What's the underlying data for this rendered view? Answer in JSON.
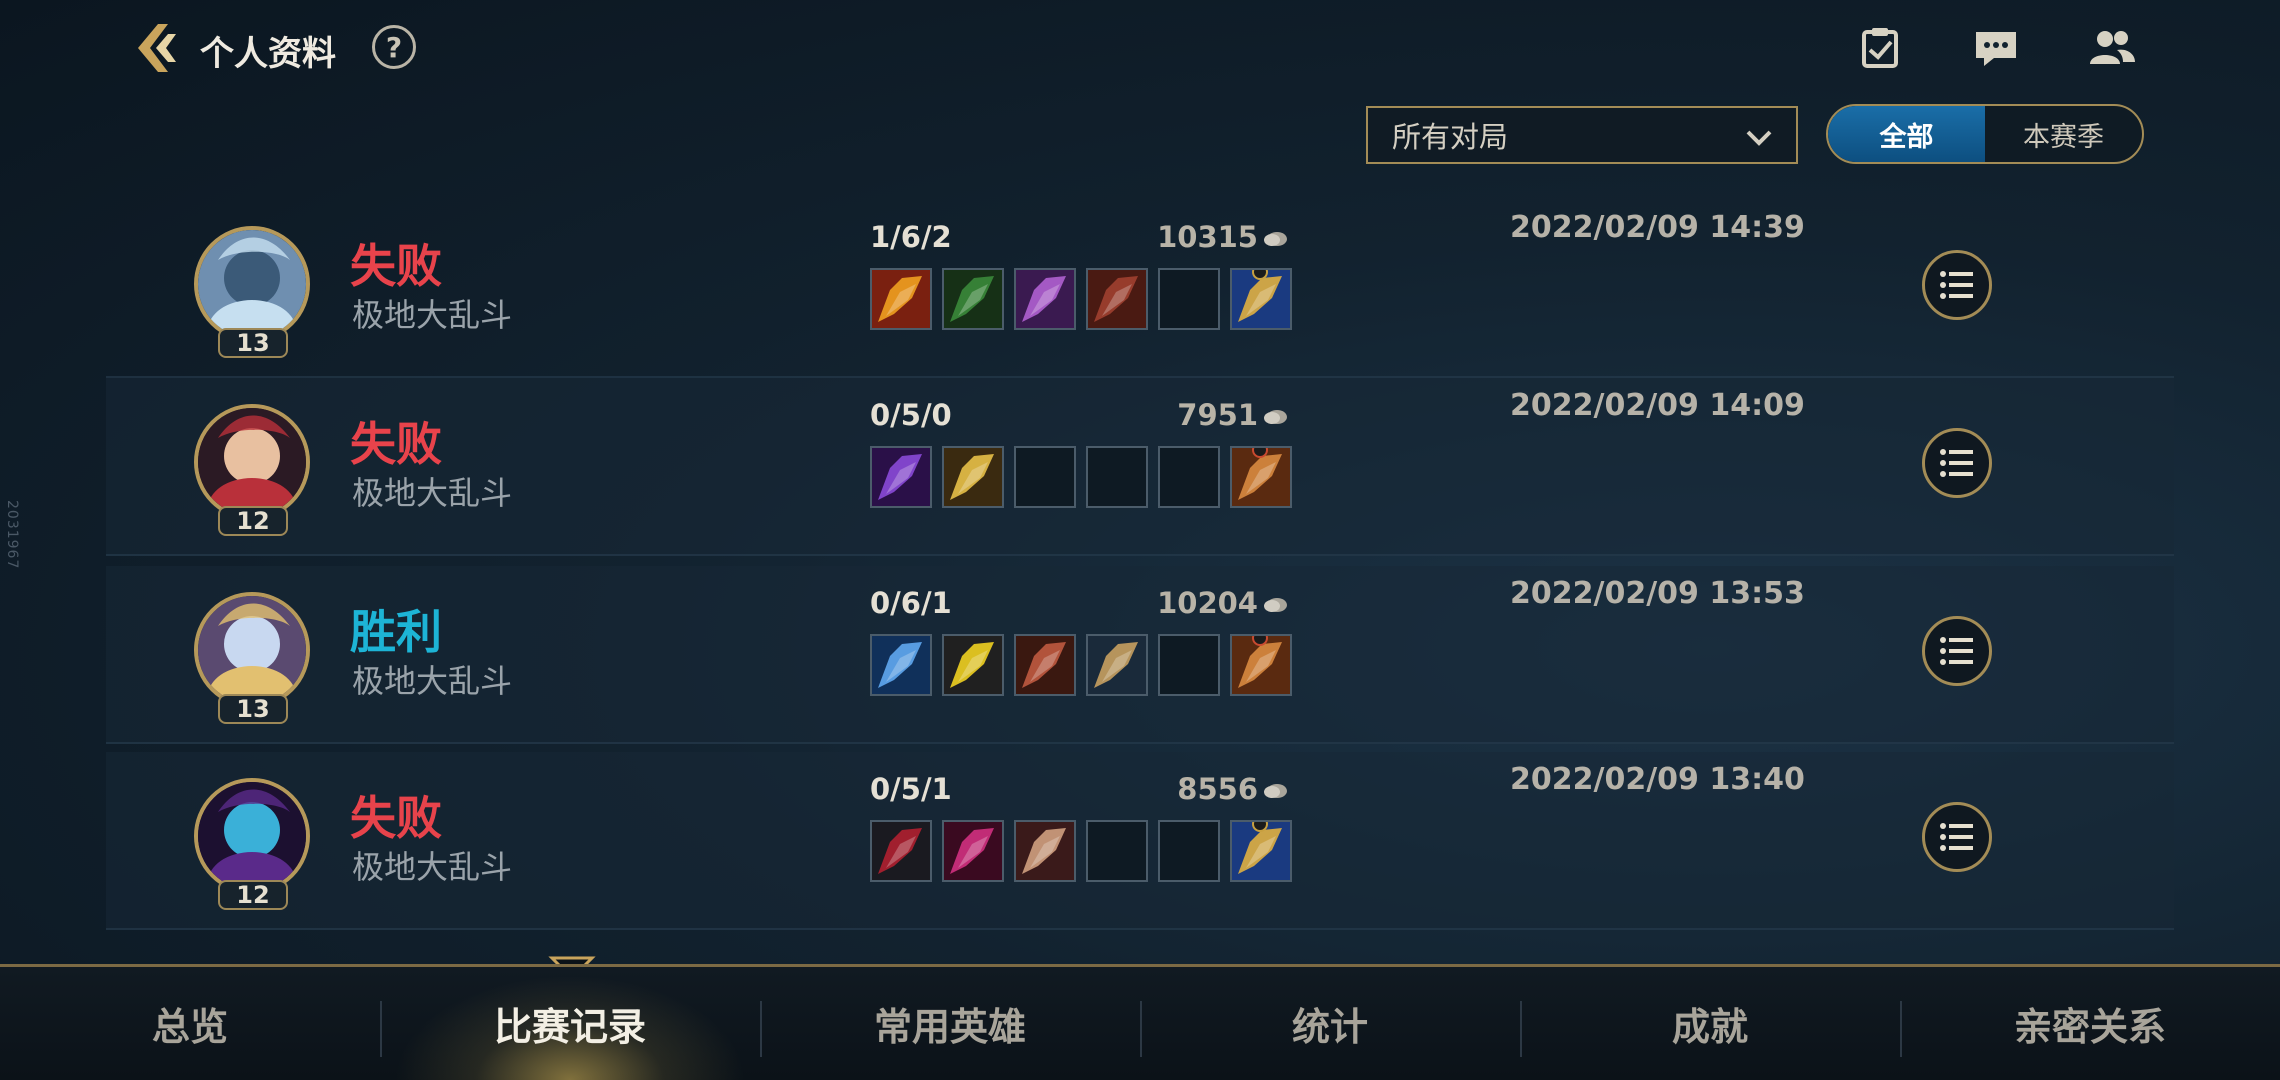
{
  "header": {
    "title": "个人资料",
    "help_label": "?"
  },
  "side_watermark": "2031967",
  "filters": {
    "match_type": "所有对局",
    "scope_tabs": [
      {
        "label": "全部",
        "active": true
      },
      {
        "label": "本赛季",
        "active": false
      }
    ]
  },
  "matches": [
    {
      "result": "失败",
      "result_type": "loss",
      "mode": "极地大乱斗",
      "level": "13",
      "kda": "1/6/2",
      "gold": "10315",
      "datetime": "2022/02/09 14:39",
      "items": [
        "fire-sword-item",
        "green-claw-item",
        "purple-orb-item",
        "red-tome-item",
        "empty",
        "golden-hourglass-item"
      ]
    },
    {
      "result": "失败",
      "result_type": "loss",
      "mode": "极地大乱斗",
      "level": "12",
      "kda": "0/5/0",
      "gold": "7951",
      "datetime": "2022/02/09 14:09",
      "items": [
        "purple-blade-item",
        "lightning-dagger-item",
        "empty",
        "empty",
        "empty",
        "poro-snax-item"
      ]
    },
    {
      "result": "胜利",
      "result_type": "win",
      "mode": "极地大乱斗",
      "level": "13",
      "kda": "0/6/1",
      "gold": "10204",
      "datetime": "2022/02/09 13:53",
      "items": [
        "ice-spear-item",
        "yellow-triangle-item",
        "bow-item",
        "crossbow-item",
        "empty",
        "poro-snax-item"
      ]
    },
    {
      "result": "失败",
      "result_type": "loss",
      "mode": "极地大乱斗",
      "level": "12",
      "kda": "0/5/1",
      "gold": "8556",
      "datetime": "2022/02/09 13:40",
      "items": [
        "dark-armor-item",
        "crimson-scythe-item",
        "rose-dagger-item",
        "empty",
        "empty",
        "golden-hourglass-item"
      ]
    }
  ],
  "bottom_nav": [
    {
      "label": "总览",
      "active": false
    },
    {
      "label": "比赛记录",
      "active": true
    },
    {
      "label": "常用英雄",
      "active": false
    },
    {
      "label": "统计",
      "active": false
    },
    {
      "label": "成就",
      "active": false
    },
    {
      "label": "亲密关系",
      "active": false
    }
  ],
  "colors": {
    "loss": "#e8434b",
    "win": "#1db4d6",
    "gold_border": "#a38c56",
    "active_tab_blue": "#1a6ea8"
  }
}
